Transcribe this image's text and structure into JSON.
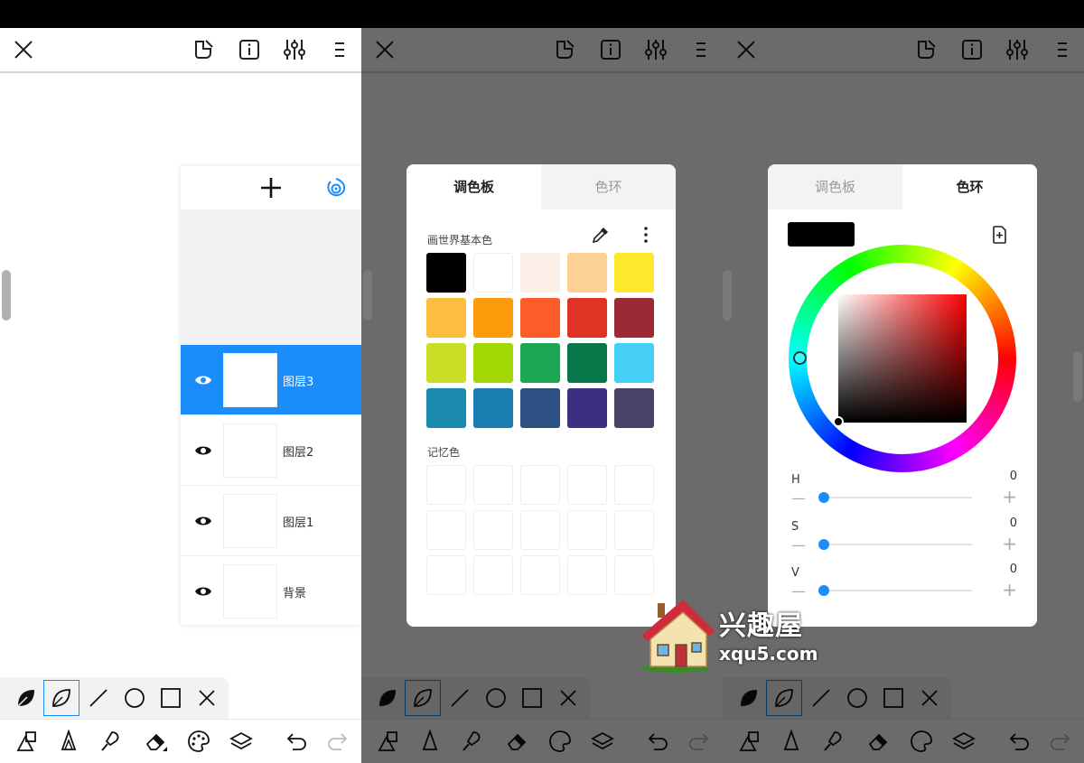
{
  "layers": {
    "items": [
      {
        "name": "图层3",
        "active": true
      },
      {
        "name": "图层2",
        "active": false
      },
      {
        "name": "图层1",
        "active": false
      },
      {
        "name": "背景",
        "active": false
      }
    ]
  },
  "palette_dialog": {
    "tabs": [
      {
        "label": "调色板"
      },
      {
        "label": "色环"
      }
    ],
    "basic_title": "画世界基本色",
    "memory_title": "记忆色",
    "basic_colors": [
      "#000000",
      "#ffffff",
      "#fbeee6",
      "#fdd194",
      "#ffe72c",
      "#fdbd3f",
      "#fd9b0d",
      "#fc5c28",
      "#df3325",
      "#9c2a35",
      "#cbde27",
      "#a1d705",
      "#1da653",
      "#07774a",
      "#45cff5",
      "#1a8aad",
      "#1a7db1",
      "#2d5083",
      "#3c2f81",
      "#4b4269"
    ],
    "memory_count": 15
  },
  "wheel_dialog": {
    "tabs": [
      {
        "label": "调色板"
      },
      {
        "label": "色环"
      }
    ],
    "current_color": "#000000",
    "hsv": [
      {
        "label": "H",
        "value": "0"
      },
      {
        "label": "S",
        "value": "0"
      },
      {
        "label": "V",
        "value": "0"
      }
    ]
  },
  "watermark": {
    "title": "兴趣屋",
    "url": "xqu5.com"
  },
  "colors": {
    "accent": "#1a8dfb",
    "dim_bg": "#666666"
  }
}
